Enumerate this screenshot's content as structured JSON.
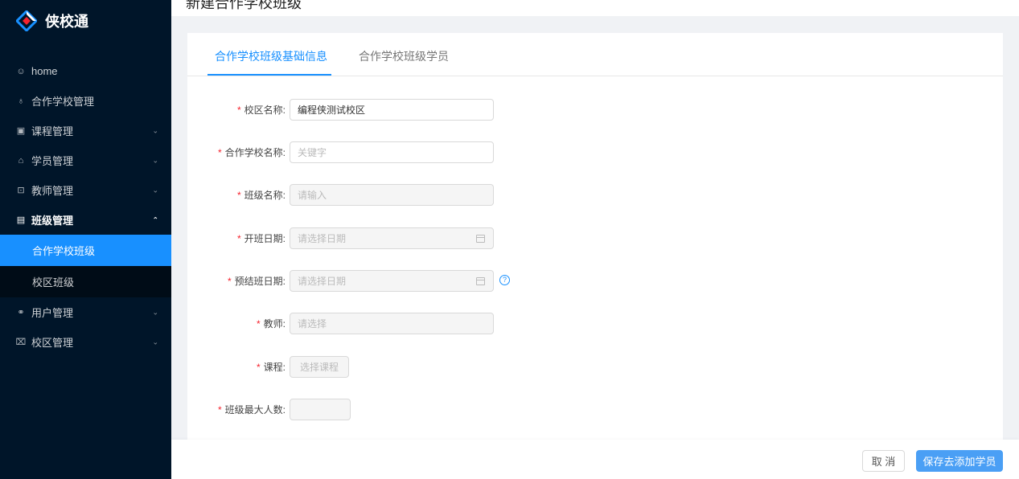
{
  "app": {
    "name": "侠校通"
  },
  "header": {
    "title": "新建合作学校班级"
  },
  "sidebar": {
    "items": [
      {
        "label": "home",
        "icon": "smile-icon",
        "chevron": ""
      },
      {
        "label": "合作学校管理",
        "icon": "school-icon",
        "chevron": ""
      },
      {
        "label": "课程管理",
        "icon": "book-icon",
        "chevron": "⌄"
      },
      {
        "label": "学员管理",
        "icon": "student-icon",
        "chevron": "⌄"
      },
      {
        "label": "教师管理",
        "icon": "teacher-icon",
        "chevron": "⌄"
      },
      {
        "label": "班级管理",
        "icon": "class-icon",
        "chevron": "⌃"
      },
      {
        "label": "用户管理",
        "icon": "user-icon",
        "chevron": "⌄"
      },
      {
        "label": "校区管理",
        "icon": "campus-icon",
        "chevron": "⌄"
      }
    ],
    "sub_items": [
      {
        "label": "合作学校班级"
      },
      {
        "label": "校区班级"
      }
    ]
  },
  "tabs": [
    {
      "label": "合作学校班级基础信息"
    },
    {
      "label": "合作学校班级学员"
    }
  ],
  "form": {
    "campus_name": {
      "label": "校区名称:",
      "value": "编程侠测试校区"
    },
    "school_name": {
      "label": "合作学校名称:",
      "placeholder": "关键字"
    },
    "class_name": {
      "label": "班级名称:",
      "placeholder": "请输入"
    },
    "start_date": {
      "label": "开班日期:",
      "placeholder": "请选择日期"
    },
    "end_date": {
      "label": "预结班日期:",
      "placeholder": "请选择日期"
    },
    "teacher": {
      "label": "教师:",
      "placeholder": "请选择"
    },
    "course": {
      "label": "课程:",
      "button": "选择课程"
    },
    "max_students": {
      "label": "班级最大人数:",
      "value": ""
    }
  },
  "footer": {
    "cancel_label": "取 消",
    "save_label": "保存去添加学员"
  },
  "colors": {
    "primary": "#1890ff",
    "sidebar_bg": "#001529",
    "required": "#f5222d"
  }
}
